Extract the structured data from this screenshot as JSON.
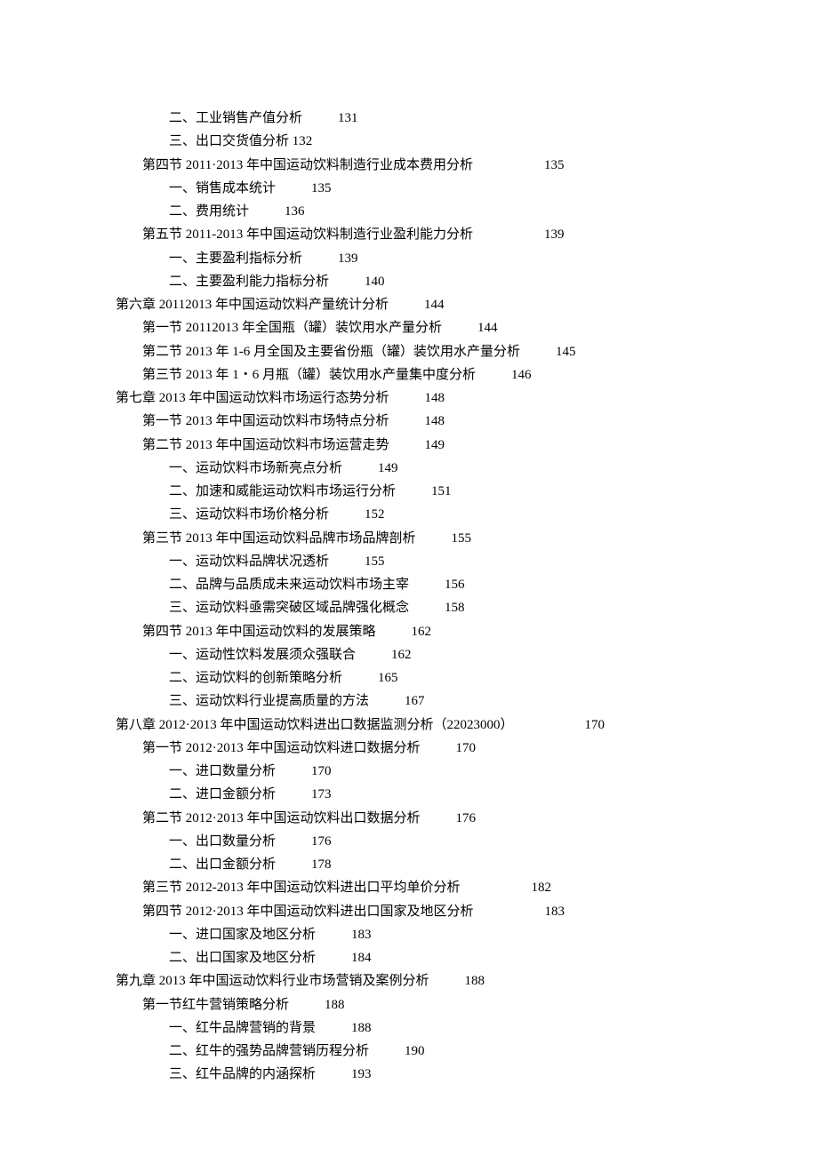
{
  "lines": [
    {
      "indent": 2,
      "title": "二、工业销售产值分析",
      "page": "131",
      "gap": "gap"
    },
    {
      "indent": 2,
      "title": "三、出口交货值分析 132",
      "page": "",
      "gap": ""
    },
    {
      "indent": 1,
      "title": "第四节 2011·2013 年中国运动饮料制造行业成本费用分析",
      "page": "135",
      "gap": "gap-wide"
    },
    {
      "indent": 2,
      "title": "一、销售成本统计",
      "page": "135",
      "gap": "gap"
    },
    {
      "indent": 2,
      "title": "二、费用统计",
      "page": "136",
      "gap": "gap"
    },
    {
      "indent": 1,
      "title": "第五节 2011-2013 年中国运动饮料制造行业盈利能力分析",
      "page": "139",
      "gap": "gap-wide"
    },
    {
      "indent": 2,
      "title": "一、主要盈利指标分析",
      "page": "139",
      "gap": "gap"
    },
    {
      "indent": 2,
      "title": "二、主要盈利能力指标分析",
      "page": "140",
      "gap": "gap"
    },
    {
      "indent": 0,
      "title": "第六章 20112013 年中国运动饮料产量统计分析",
      "page": "144",
      "gap": "gap"
    },
    {
      "indent": 1,
      "title": "第一节 20112013 年全国瓶（罐）装饮用水产量分析",
      "page": "144",
      "gap": "gap"
    },
    {
      "indent": 1,
      "title": "第二节 2013 年 1-6 月全国及主要省份瓶（罐）装饮用水产量分析",
      "page": "145",
      "gap": "gap"
    },
    {
      "indent": 1,
      "title": "第三节 2013 年 1・6 月瓶（罐）装饮用水产量集中度分析",
      "page": "146",
      "gap": "gap"
    },
    {
      "indent": 0,
      "title": "第七章 2013 年中国运动饮料市场运行态势分析",
      "page": "148",
      "gap": "gap"
    },
    {
      "indent": 1,
      "title": "第一节 2013 年中国运动饮料市场特点分析",
      "page": "148",
      "gap": "gap"
    },
    {
      "indent": 1,
      "title": "第二节 2013 年中国运动饮料市场运营走势",
      "page": "149",
      "gap": "gap"
    },
    {
      "indent": 2,
      "title": "一、运动饮料市场新亮点分析",
      "page": "149",
      "gap": "gap"
    },
    {
      "indent": 2,
      "title": "二、加速和威能运动饮料市场运行分析",
      "page": "151",
      "gap": "gap"
    },
    {
      "indent": 2,
      "title": "三、运动饮料市场价格分析",
      "page": "152",
      "gap": "gap"
    },
    {
      "indent": 1,
      "title": "第三节 2013 年中国运动饮料品牌市场品牌剖析",
      "page": "155",
      "gap": "gap"
    },
    {
      "indent": 2,
      "title": "一、运动饮料品牌状况透析",
      "page": "155",
      "gap": "gap"
    },
    {
      "indent": 2,
      "title": "二、品牌与品质成未来运动饮料市场主宰",
      "page": "156",
      "gap": "gap"
    },
    {
      "indent": 2,
      "title": "三、运动饮料亟需突破区域品牌强化概念",
      "page": "158",
      "gap": "gap"
    },
    {
      "indent": 1,
      "title": "第四节 2013 年中国运动饮料的发展策略",
      "page": "162",
      "gap": "gap"
    },
    {
      "indent": 2,
      "title": "一、运动性饮料发展须众强联合",
      "page": "162",
      "gap": "gap"
    },
    {
      "indent": 2,
      "title": "二、运动饮料的创新策略分析",
      "page": "165",
      "gap": "gap"
    },
    {
      "indent": 2,
      "title": "三、运动饮料行业提高质量的方法",
      "page": "167",
      "gap": "gap"
    },
    {
      "indent": 0,
      "title": "第八章 2012·2013 年中国运动饮料进出口数据监测分析（22023000）",
      "page": "170",
      "gap": "gap-wide"
    },
    {
      "indent": 1,
      "title": "第一节 2012·2013 年中国运动饮料进口数据分析",
      "page": "170",
      "gap": "gap"
    },
    {
      "indent": 2,
      "title": "一、进口数量分析",
      "page": "170",
      "gap": "gap"
    },
    {
      "indent": 2,
      "title": "二、进口金额分析",
      "page": "173",
      "gap": "gap"
    },
    {
      "indent": 1,
      "title": "第二节 2012·2013 年中国运动饮料出口数据分析",
      "page": "176",
      "gap": "gap"
    },
    {
      "indent": 2,
      "title": "一、出口数量分析",
      "page": "176",
      "gap": "gap"
    },
    {
      "indent": 2,
      "title": "二、出口金额分析",
      "page": "178",
      "gap": "gap"
    },
    {
      "indent": 1,
      "title": "第三节 2012-2013 年中国运动饮料进出口平均单价分析",
      "page": "182",
      "gap": "gap-wide"
    },
    {
      "indent": 1,
      "title": "第四节 2012·2013 年中国运动饮料进出口国家及地区分析",
      "page": "183",
      "gap": "gap-wide"
    },
    {
      "indent": 2,
      "title": "一、进口国家及地区分析",
      "page": "183",
      "gap": "gap"
    },
    {
      "indent": 2,
      "title": "二、出口国家及地区分析",
      "page": "184",
      "gap": "gap"
    },
    {
      "indent": 0,
      "title": "第九章 2013 年中国运动饮料行业市场营销及案例分析",
      "page": "188",
      "gap": "gap"
    },
    {
      "indent": 1,
      "title": "第一节红牛营销策略分析",
      "page": "188",
      "gap": "gap"
    },
    {
      "indent": 2,
      "title": "一、红牛品牌营销的背景",
      "page": "188",
      "gap": "gap"
    },
    {
      "indent": 2,
      "title": "二、红牛的强势品牌营销历程分析",
      "page": "190",
      "gap": "gap"
    },
    {
      "indent": 2,
      "title": "三、红牛品牌的内涵探析",
      "page": "193",
      "gap": "gap"
    }
  ]
}
